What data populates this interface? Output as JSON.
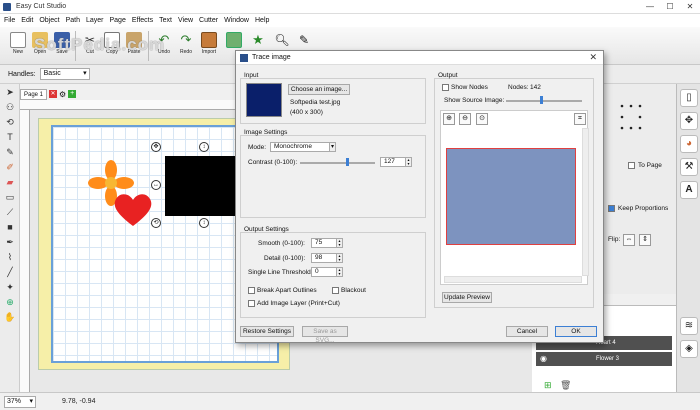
{
  "app": {
    "title": "Easy Cut Studio",
    "window_controls": [
      "—",
      "☐",
      "✕"
    ]
  },
  "menu": [
    "File",
    "Edit",
    "Object",
    "Path",
    "Layer",
    "Page",
    "Effects",
    "Text",
    "View",
    "Cutter",
    "Window",
    "Help"
  ],
  "toolbar": {
    "buttons": [
      {
        "label": "New",
        "icon": "new-file-icon"
      },
      {
        "label": "Open",
        "icon": "open-folder-icon"
      },
      {
        "label": "Save",
        "icon": "save-icon"
      },
      {
        "label": "Cut",
        "icon": "scissors-icon"
      },
      {
        "label": "Copy",
        "icon": "copy-icon"
      },
      {
        "label": "Paste",
        "icon": "paste-icon"
      },
      {
        "label": "Undo",
        "icon": "undo-icon"
      },
      {
        "label": "Redo",
        "icon": "redo-icon"
      },
      {
        "label": "Import",
        "icon": "import-icon"
      }
    ],
    "watermark": "SoftPedia.com"
  },
  "handles": {
    "label": "Handles:",
    "value": "Basic"
  },
  "page_tab": {
    "label": "Page 1"
  },
  "status": {
    "zoom": "37%",
    "coords": "9.78, -0.94"
  },
  "right_panel": {
    "to_page": "To Page",
    "keep_proportions": "Keep Proportions",
    "flip": "Flip:"
  },
  "layers": [
    {
      "name": "Heart 4"
    },
    {
      "name": "Flower 3"
    }
  ],
  "dialog": {
    "title": "Trace image",
    "input": {
      "group_label": "Input",
      "choose_button": "Choose an image...",
      "filename": "Softpedia test.jpg",
      "dimensions": "(400 x 300)"
    },
    "image_settings": {
      "group_label": "Image Settings",
      "mode_label": "Mode:",
      "mode_value": "Monochrome",
      "contrast_label": "Contrast (0-100):",
      "contrast_value": "127",
      "contrast_level": 0.62
    },
    "output_settings": {
      "group_label": "Output Settings",
      "smooth_label": "Smooth (0-100):",
      "smooth_value": "75",
      "detail_label": "Detail (0-100):",
      "detail_value": "98",
      "threshold_label": "Single Line Threshold:",
      "threshold_value": "0",
      "break_apart": "Break Apart Outlines",
      "blackout": "Blackout",
      "add_image_layer": "Add Image Layer (Print+Cut)"
    },
    "output": {
      "group_label": "Output",
      "show_nodes": "Show Nodes",
      "nodes_label": "Nodes:",
      "nodes_count": "142",
      "show_source": "Show Source Image:",
      "update_preview": "Update Preview"
    },
    "buttons": {
      "restore": "Restore Settings",
      "save_svg": "Save as SVG...",
      "cancel": "Cancel",
      "ok": "OK"
    }
  }
}
